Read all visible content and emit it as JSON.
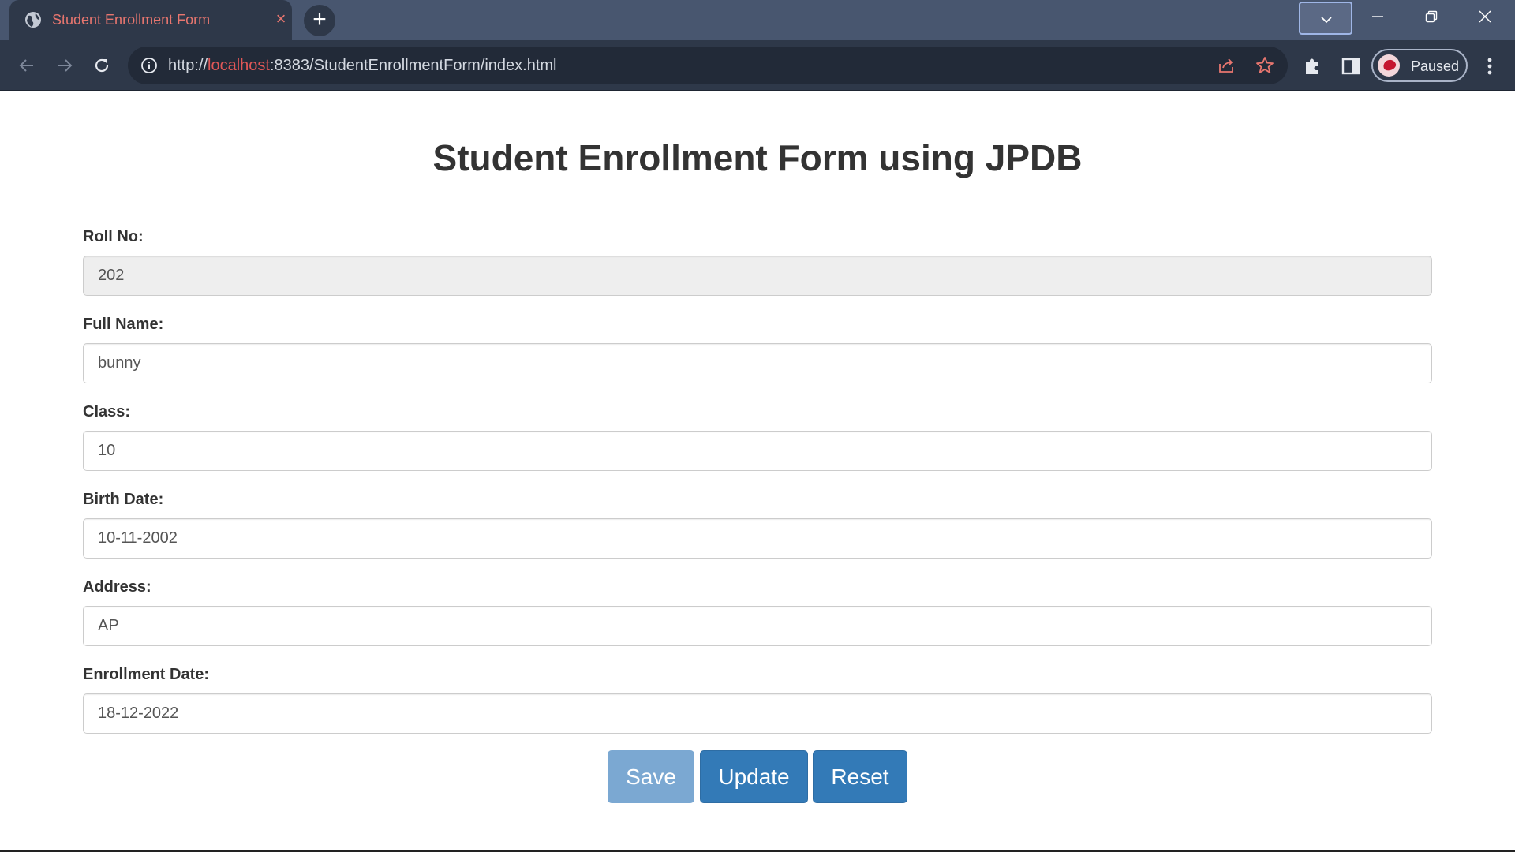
{
  "browser": {
    "tab_title": "Student Enrollment Form",
    "url_scheme": "http://",
    "url_host": "localhost",
    "url_rest": ":8383/StudentEnrollmentForm/index.html",
    "profile_label": "Paused",
    "colors": {
      "tabbar": "#48566f",
      "toolbar": "#2e3849",
      "tab_text": "#e8766f",
      "url_host": "#e05757"
    }
  },
  "form": {
    "title": "Student Enrollment Form using JPDB",
    "fields": [
      {
        "label": "Roll No:",
        "value": "202",
        "readonly": true
      },
      {
        "label": "Full Name:",
        "value": "bunny",
        "readonly": false
      },
      {
        "label": "Class:",
        "value": "10",
        "readonly": false
      },
      {
        "label": "Birth Date:",
        "value": "10-11-2002",
        "readonly": false
      },
      {
        "label": "Address:",
        "value": "AP",
        "readonly": false
      },
      {
        "label": "Enrollment Date:",
        "value": "18-12-2022",
        "readonly": false
      }
    ],
    "buttons": {
      "save": {
        "label": "Save",
        "disabled": true
      },
      "update": {
        "label": "Update",
        "disabled": false
      },
      "reset": {
        "label": "Reset",
        "disabled": false
      }
    },
    "colors": {
      "primary": "#337ab7",
      "primary_disabled": "#7ba8d2",
      "readonly_bg": "#eeeeee"
    }
  }
}
